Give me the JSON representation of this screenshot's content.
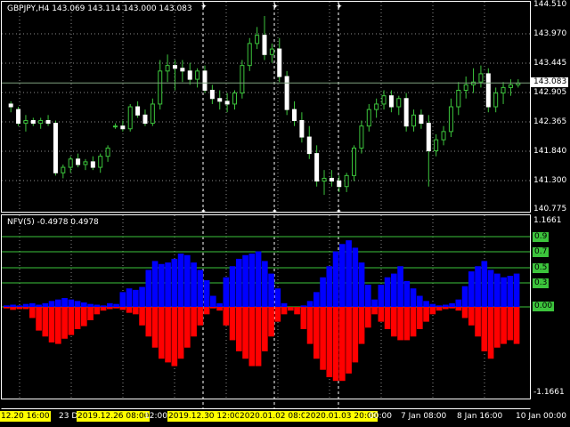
{
  "window": {
    "symbol_label": "GBPJPY,H4",
    "ohlc_label": "143.069 143.114 143.000 143.083",
    "indicator_label": "NFV(5) -0.4978 0.4978"
  },
  "price_axis": {
    "labels": [
      "144.510",
      "143.970",
      "143.445",
      "142.905",
      "142.365",
      "141.840",
      "141.300",
      "140.775"
    ],
    "current_price": "143.083"
  },
  "indicator_axis": {
    "labels": [
      "1.1661",
      "-1.1661"
    ],
    "levels": [
      "0.9",
      "0.7",
      "0.5",
      "0.3",
      "0.00"
    ]
  },
  "time_axis": [
    {
      "text": "12.20 16:00",
      "highlight": true
    },
    {
      "text": "23 D",
      "highlight": false
    },
    {
      "text": "2019.12.26 08:00",
      "highlight": true
    },
    {
      "text": "12:00",
      "highlight": false
    },
    {
      "text": "2019.12.30 12:00",
      "highlight": true
    },
    {
      "text": "2020.01.02 08:0",
      "highlight": true
    },
    {
      "text": "2020.01.03 20:00",
      "highlight": true
    },
    {
      "text": "00:00",
      "highlight": false
    },
    {
      "text": "7 Jan 08:00",
      "highlight": false
    },
    {
      "text": "8 Jan 16:00",
      "highlight": false
    },
    {
      "text": "10 Jan 00:00",
      "highlight": false
    }
  ],
  "colors": {
    "background": "#000000",
    "grid": "#ffffff",
    "candle": "#3cc43c",
    "level_line": "#3cc43c",
    "histogram_positive": "#0000ff",
    "histogram_negative": "#ff0000",
    "price_line": "#7fa07f"
  },
  "chart_data": {
    "type": "candlestick",
    "candles": [
      {
        "o": 142.7,
        "h": 142.75,
        "l": 142.55,
        "c": 142.65
      },
      {
        "o": 142.6,
        "h": 142.65,
        "l": 142.3,
        "c": 142.35
      },
      {
        "o": 142.35,
        "h": 142.5,
        "l": 142.2,
        "c": 142.4
      },
      {
        "o": 142.4,
        "h": 142.45,
        "l": 142.3,
        "c": 142.35
      },
      {
        "o": 142.35,
        "h": 142.45,
        "l": 142.25,
        "c": 142.4
      },
      {
        "o": 142.4,
        "h": 142.5,
        "l": 142.3,
        "c": 142.35
      },
      {
        "o": 142.35,
        "h": 142.4,
        "l": 141.4,
        "c": 141.45
      },
      {
        "o": 141.45,
        "h": 141.6,
        "l": 141.35,
        "c": 141.55
      },
      {
        "o": 141.55,
        "h": 141.75,
        "l": 141.45,
        "c": 141.7
      },
      {
        "o": 141.7,
        "h": 141.8,
        "l": 141.55,
        "c": 141.6
      },
      {
        "o": 141.6,
        "h": 141.7,
        "l": 141.5,
        "c": 141.65
      },
      {
        "o": 141.65,
        "h": 141.75,
        "l": 141.5,
        "c": 141.55
      },
      {
        "o": 141.55,
        "h": 141.8,
        "l": 141.45,
        "c": 141.75
      },
      {
        "o": 141.75,
        "h": 141.95,
        "l": 141.65,
        "c": 141.9
      },
      {
        "o": 142.3,
        "h": 142.35,
        "l": 142.25,
        "c": 142.3
      },
      {
        "o": 142.3,
        "h": 142.4,
        "l": 142.2,
        "c": 142.25
      },
      {
        "o": 142.25,
        "h": 142.7,
        "l": 142.2,
        "c": 142.65
      },
      {
        "o": 142.65,
        "h": 142.75,
        "l": 142.45,
        "c": 142.5
      },
      {
        "o": 142.5,
        "h": 142.6,
        "l": 142.3,
        "c": 142.35
      },
      {
        "o": 142.35,
        "h": 142.8,
        "l": 142.3,
        "c": 142.7
      },
      {
        "o": 142.7,
        "h": 143.5,
        "l": 142.6,
        "c": 143.3
      },
      {
        "o": 143.3,
        "h": 143.6,
        "l": 143.1,
        "c": 143.4
      },
      {
        "o": 143.4,
        "h": 143.5,
        "l": 142.95,
        "c": 143.35
      },
      {
        "o": 143.35,
        "h": 143.5,
        "l": 143.1,
        "c": 143.3
      },
      {
        "o": 143.3,
        "h": 143.45,
        "l": 143.05,
        "c": 143.15
      },
      {
        "o": 143.15,
        "h": 143.35,
        "l": 143.0,
        "c": 143.3
      },
      {
        "o": 143.3,
        "h": 143.4,
        "l": 142.9,
        "c": 142.95
      },
      {
        "o": 142.95,
        "h": 143.05,
        "l": 142.7,
        "c": 142.8
      },
      {
        "o": 142.8,
        "h": 142.95,
        "l": 142.6,
        "c": 142.75
      },
      {
        "o": 142.75,
        "h": 142.9,
        "l": 142.55,
        "c": 142.7
      },
      {
        "o": 142.7,
        "h": 142.95,
        "l": 142.6,
        "c": 142.9
      },
      {
        "o": 142.9,
        "h": 143.5,
        "l": 142.8,
        "c": 143.4
      },
      {
        "o": 143.4,
        "h": 143.9,
        "l": 143.3,
        "c": 143.8
      },
      {
        "o": 143.8,
        "h": 144.1,
        "l": 143.7,
        "c": 143.95
      },
      {
        "o": 143.95,
        "h": 144.3,
        "l": 143.5,
        "c": 143.6
      },
      {
        "o": 143.6,
        "h": 143.8,
        "l": 143.45,
        "c": 143.7
      },
      {
        "o": 143.7,
        "h": 143.9,
        "l": 143.1,
        "c": 143.2
      },
      {
        "o": 143.2,
        "h": 143.3,
        "l": 142.5,
        "c": 142.6
      },
      {
        "o": 142.6,
        "h": 142.75,
        "l": 142.3,
        "c": 142.4
      },
      {
        "o": 142.4,
        "h": 142.55,
        "l": 142.0,
        "c": 142.1
      },
      {
        "o": 142.1,
        "h": 142.3,
        "l": 141.7,
        "c": 141.8
      },
      {
        "o": 141.8,
        "h": 141.95,
        "l": 141.2,
        "c": 141.3
      },
      {
        "o": 141.3,
        "h": 141.5,
        "l": 141.05,
        "c": 141.35
      },
      {
        "o": 141.35,
        "h": 141.5,
        "l": 141.2,
        "c": 141.3
      },
      {
        "o": 141.3,
        "h": 141.4,
        "l": 141.1,
        "c": 141.2
      },
      {
        "o": 141.2,
        "h": 141.45,
        "l": 141.1,
        "c": 141.4
      },
      {
        "o": 141.4,
        "h": 141.95,
        "l": 141.3,
        "c": 141.9
      },
      {
        "o": 141.9,
        "h": 142.4,
        "l": 141.8,
        "c": 142.3
      },
      {
        "o": 142.3,
        "h": 142.7,
        "l": 142.2,
        "c": 142.6
      },
      {
        "o": 142.6,
        "h": 142.8,
        "l": 142.45,
        "c": 142.7
      },
      {
        "o": 142.7,
        "h": 142.95,
        "l": 142.6,
        "c": 142.85
      },
      {
        "o": 142.85,
        "h": 142.95,
        "l": 142.55,
        "c": 142.65
      },
      {
        "o": 142.65,
        "h": 142.85,
        "l": 142.5,
        "c": 142.8
      },
      {
        "o": 142.8,
        "h": 142.9,
        "l": 142.2,
        "c": 142.3
      },
      {
        "o": 142.3,
        "h": 142.6,
        "l": 142.2,
        "c": 142.5
      },
      {
        "o": 142.5,
        "h": 142.6,
        "l": 142.25,
        "c": 142.35
      },
      {
        "o": 142.35,
        "h": 142.5,
        "l": 141.2,
        "c": 141.85
      },
      {
        "o": 141.85,
        "h": 142.15,
        "l": 141.75,
        "c": 142.05
      },
      {
        "o": 142.05,
        "h": 142.3,
        "l": 141.95,
        "c": 142.2
      },
      {
        "o": 142.2,
        "h": 142.8,
        "l": 142.1,
        "c": 142.65
      },
      {
        "o": 142.65,
        "h": 143.1,
        "l": 142.5,
        "c": 142.95
      },
      {
        "o": 142.95,
        "h": 143.2,
        "l": 142.8,
        "c": 143.05
      },
      {
        "o": 143.05,
        "h": 143.35,
        "l": 142.9,
        "c": 143.1
      },
      {
        "o": 143.1,
        "h": 143.4,
        "l": 143.0,
        "c": 143.25
      },
      {
        "o": 143.25,
        "h": 143.35,
        "l": 142.55,
        "c": 142.65
      },
      {
        "o": 142.65,
        "h": 143.0,
        "l": 142.55,
        "c": 142.9
      },
      {
        "o": 142.9,
        "h": 143.1,
        "l": 142.7,
        "c": 143.0
      },
      {
        "o": 143.0,
        "h": 143.15,
        "l": 142.85,
        "c": 143.05
      },
      {
        "o": 143.05,
        "h": 143.15,
        "l": 143.0,
        "c": 143.08
      }
    ],
    "ylim": [
      140.775,
      144.51
    ],
    "histogram": {
      "ylim": [
        -1.1661,
        1.1661
      ],
      "positive": [
        0.02,
        0.03,
        0.02,
        0.04,
        0.05,
        0.03,
        0.05,
        0.08,
        0.1,
        0.12,
        0.1,
        0.08,
        0.06,
        0.04,
        0.03,
        0.02,
        0.05,
        0.04,
        0.2,
        0.25,
        0.23,
        0.27,
        0.5,
        0.62,
        0.58,
        0.6,
        0.65,
        0.72,
        0.7,
        0.6,
        0.5,
        0.36,
        0.15,
        0.05,
        0.4,
        0.55,
        0.65,
        0.7,
        0.72,
        0.75,
        0.62,
        0.45,
        0.25,
        0.05,
        0.0,
        0.0,
        0.02,
        0.08,
        0.2,
        0.4,
        0.55,
        0.75,
        0.85,
        0.9,
        0.8,
        0.6,
        0.3,
        0.1,
        0.3,
        0.4,
        0.45,
        0.55,
        0.35,
        0.25,
        0.15,
        0.08,
        0.04,
        0.02,
        0.03,
        0.05,
        0.1,
        0.28,
        0.48,
        0.55,
        0.62,
        0.5,
        0.45,
        0.4,
        0.42,
        0.45
      ],
      "negative": [
        0.02,
        0.04,
        0.03,
        0.03,
        0.15,
        0.32,
        0.4,
        0.48,
        0.5,
        0.43,
        0.38,
        0.3,
        0.26,
        0.18,
        0.1,
        0.05,
        0.03,
        0.02,
        0.04,
        0.08,
        0.1,
        0.25,
        0.4,
        0.55,
        0.7,
        0.75,
        0.8,
        0.7,
        0.55,
        0.4,
        0.25,
        0.1,
        0.02,
        0.05,
        0.25,
        0.45,
        0.6,
        0.7,
        0.8,
        0.8,
        0.6,
        0.4,
        0.2,
        0.1,
        0.05,
        0.1,
        0.3,
        0.5,
        0.7,
        0.85,
        0.95,
        1.0,
        1.0,
        0.9,
        0.75,
        0.5,
        0.28,
        0.1,
        0.2,
        0.3,
        0.4,
        0.45,
        0.45,
        0.4,
        0.3,
        0.2,
        0.1,
        0.05,
        0.03,
        0.02,
        0.05,
        0.15,
        0.25,
        0.4,
        0.6,
        0.7,
        0.55,
        0.5,
        0.45,
        0.5
      ]
    }
  }
}
